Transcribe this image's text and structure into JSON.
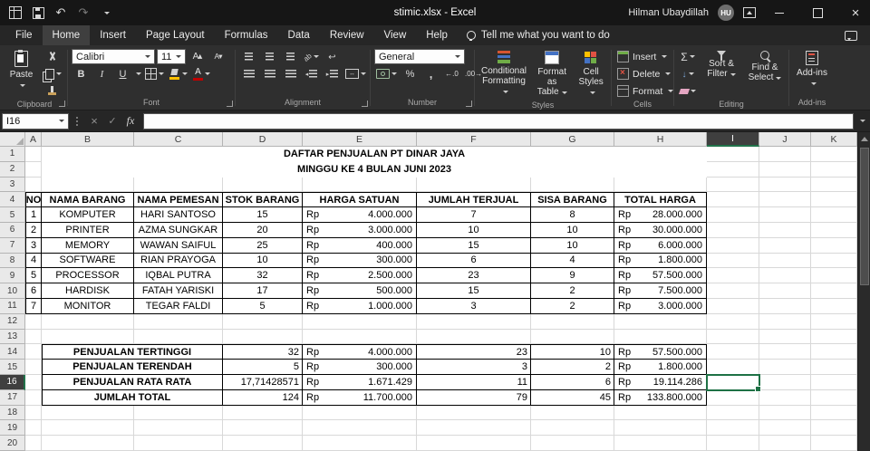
{
  "title_bar": {
    "document_title": "stimic.xlsx - Excel",
    "user": "Hilman Ubaydillah",
    "user_initials": "HU"
  },
  "tabs": {
    "items": [
      "File",
      "Home",
      "Insert",
      "Page Layout",
      "Formulas",
      "Data",
      "Review",
      "View",
      "Help"
    ],
    "active": "Home",
    "tell_me": "Tell me what you want to do"
  },
  "ribbon": {
    "groups": [
      "Clipboard",
      "Font",
      "Alignment",
      "Number",
      "Styles",
      "Cells",
      "Editing",
      "Add-ins"
    ],
    "clipboard": {
      "paste": "Paste"
    },
    "font": {
      "name": "Calibri",
      "size": "11"
    },
    "number": {
      "format": "General"
    },
    "styles": {
      "conditional": "Conditional Formatting",
      "format_table": "Format as Table",
      "cell_styles": "Cell Styles"
    },
    "cells": {
      "insert": "Insert",
      "delete": "Delete",
      "format": "Format"
    },
    "editing": {
      "sort_filter": "Sort & Filter",
      "find_select": "Find & Select"
    },
    "addins": {
      "label": "Add-ins"
    }
  },
  "formula_bar": {
    "name_box": "I16",
    "formula": ""
  },
  "grid": {
    "columns": [
      "A",
      "B",
      "C",
      "D",
      "E",
      "F",
      "G",
      "H",
      "I",
      "J",
      "K"
    ],
    "row_count": 20,
    "selected_cell": "I16",
    "selected_col": "I",
    "selected_row": 16
  },
  "sheet": {
    "title1": "DAFTAR PENJUALAN PT DINAR JAYA",
    "title2": "MINGGU KE 4 BULAN JUNI 2023",
    "currency": "Rp",
    "table": {
      "headers": [
        "NO",
        "NAMA BARANG",
        "NAMA PEMESAN",
        "STOK BARANG",
        "HARGA SATUAN",
        "JUMLAH TERJUAL",
        "SISA BARANG",
        "TOTAL HARGA"
      ],
      "rows": [
        [
          "1",
          "KOMPUTER",
          "HARI SANTOSO",
          "15",
          "4.000.000",
          "7",
          "8",
          "28.000.000"
        ],
        [
          "2",
          "PRINTER",
          "AZMA SUNGKAR",
          "20",
          "3.000.000",
          "10",
          "10",
          "30.000.000"
        ],
        [
          "3",
          "MEMORY",
          "WAWAN SAIFUL",
          "25",
          "400.000",
          "15",
          "10",
          "6.000.000"
        ],
        [
          "4",
          "SOFTWARE",
          "RIAN PRAYOGA",
          "10",
          "300.000",
          "6",
          "4",
          "1.800.000"
        ],
        [
          "5",
          "PROCESSOR",
          "IQBAL PUTRA",
          "32",
          "2.500.000",
          "23",
          "9",
          "57.500.000"
        ],
        [
          "6",
          "HARDISK",
          "FATAH YARISKI",
          "17",
          "500.000",
          "15",
          "2",
          "7.500.000"
        ],
        [
          "7",
          "MONITOR",
          "TEGAR FALDI",
          "5",
          "1.000.000",
          "3",
          "2",
          "3.000.000"
        ]
      ]
    },
    "summary": [
      [
        "PENJUALAN TERTINGGI",
        "32",
        "4.000.000",
        "23",
        "10",
        "57.500.000"
      ],
      [
        "PENJUALAN TERENDAH",
        "5",
        "300.000",
        "3",
        "2",
        "1.800.000"
      ],
      [
        "PENJUALAN RATA RATA",
        "17,71428571",
        "1.671.429",
        "11",
        "6",
        "19.114.286"
      ],
      [
        "JUMLAH TOTAL",
        "124",
        "11.700.000",
        "79",
        "45",
        "133.800.000"
      ]
    ]
  }
}
